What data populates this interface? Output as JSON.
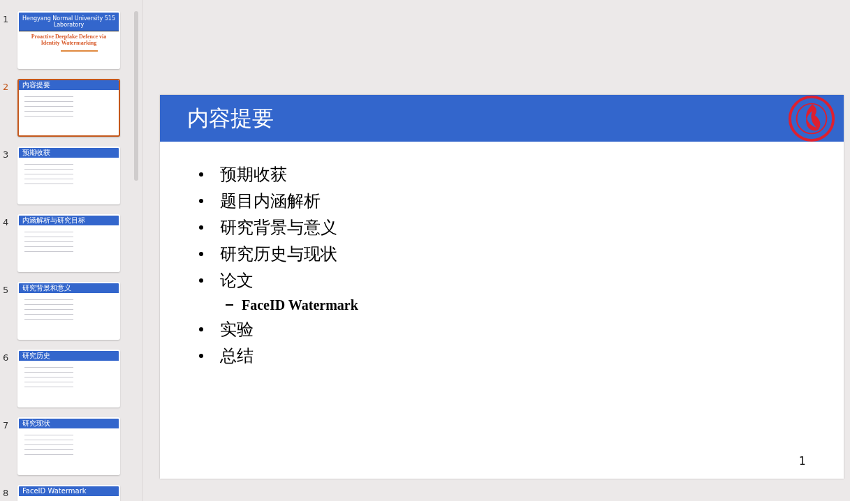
{
  "thumbnails": [
    {
      "number": "1",
      "selected": false,
      "kind": "title",
      "header": "Hengyang Normal University 515 Laboratory",
      "title": "Proactive Deepfake Defence via Identity Watermarking"
    },
    {
      "number": "2",
      "selected": true,
      "kind": "content",
      "title": "内容提要"
    },
    {
      "number": "3",
      "selected": false,
      "kind": "content",
      "title": "预期收获"
    },
    {
      "number": "4",
      "selected": false,
      "kind": "content",
      "title": "内涵解析与研究目标"
    },
    {
      "number": "5",
      "selected": false,
      "kind": "content",
      "title": "研究背景和意义"
    },
    {
      "number": "6",
      "selected": false,
      "kind": "content",
      "title": "研究历史"
    },
    {
      "number": "7",
      "selected": false,
      "kind": "content",
      "title": "研究现状"
    },
    {
      "number": "8",
      "selected": false,
      "kind": "content",
      "title": "FaceID Watermark"
    }
  ],
  "slide": {
    "title": "内容提要",
    "bullets": [
      {
        "text": "预期收获"
      },
      {
        "text": "题目内涵解析"
      },
      {
        "text": "研究背景与意义"
      },
      {
        "text": "研究历史与现状"
      },
      {
        "text": "论文",
        "children": [
          {
            "text": "FaceID Watermark"
          }
        ]
      },
      {
        "text": "实验"
      },
      {
        "text": "总结"
      }
    ],
    "page_number": "1"
  }
}
